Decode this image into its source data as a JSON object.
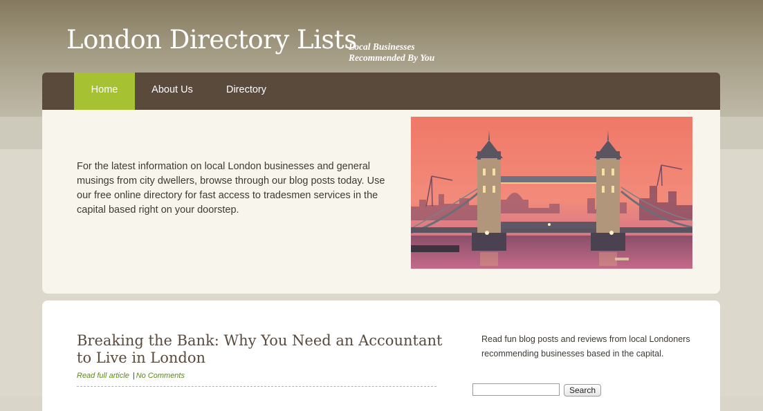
{
  "header": {
    "site_title": "London Directory Lists",
    "tagline_line1": "Local Businesses",
    "tagline_line2": "Recommended By You"
  },
  "nav": {
    "items": [
      {
        "label": "Home",
        "active": true
      },
      {
        "label": "About Us",
        "active": false
      },
      {
        "label": "Directory",
        "active": false
      }
    ]
  },
  "hero": {
    "text": "For the latest information on local London businesses and general musings from city dwellers, browse through our blog posts today. Use our free online directory for fast access to tradesmen services in the capital based right on your doorstep.",
    "image": "tower-bridge-photo"
  },
  "post": {
    "title": "Breaking the Bank: Why You Need an Accountant to Live in London",
    "read_more": "Read full article",
    "separator": "|",
    "comments": "No Comments"
  },
  "sidebar": {
    "text": "Read fun blog posts and reviews from local Londoners recommending businesses based in the capital.",
    "search_value": "",
    "search_button": "Search"
  },
  "colors": {
    "nav_bg": "#5a4a3c",
    "nav_active": "#a6c232",
    "hero_bg": "#f8f5ec",
    "link_green": "#5a8a14",
    "title_brown": "#5a4a3c"
  }
}
